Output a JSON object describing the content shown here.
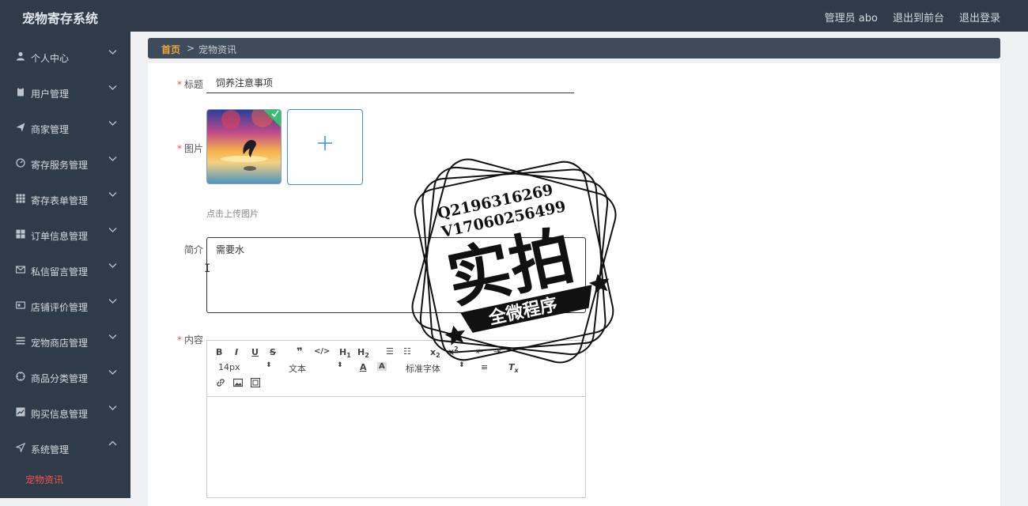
{
  "app": {
    "title": "宠物寄存系统"
  },
  "top_links": {
    "admin": "管理员 abo",
    "front": "退出到前台",
    "logout": "退出登录"
  },
  "sidebar": {
    "items": [
      {
        "label": "个人中心",
        "icon": "user-icon"
      },
      {
        "label": "用户管理",
        "icon": "clipboard-icon"
      },
      {
        "label": "商家管理",
        "icon": "paper-plane-icon"
      },
      {
        "label": "寄存服务管理",
        "icon": "dashboard-icon"
      },
      {
        "label": "寄存表单管理",
        "icon": "grid-icon"
      },
      {
        "label": "订单信息管理",
        "icon": "apps-icon"
      },
      {
        "label": "私信留言管理",
        "icon": "mail-icon"
      },
      {
        "label": "店铺评价管理",
        "icon": "card-icon"
      },
      {
        "label": "宠物商店管理",
        "icon": "list-icon"
      },
      {
        "label": "商品分类管理",
        "icon": "compass-icon"
      },
      {
        "label": "购买信息管理",
        "icon": "chart-icon"
      },
      {
        "label": "系统管理",
        "icon": "send-icon"
      }
    ],
    "sub_item": "宠物资讯"
  },
  "breadcrumb": {
    "home": "首页",
    "separator": ">",
    "current": "宠物资讯"
  },
  "form": {
    "title_label": "标题",
    "title_value": "饲养注意事项",
    "image_label": "图片",
    "upload_hint": "点击上传图片",
    "intro_label": "简介",
    "intro_value": "需要水",
    "content_label": "内容",
    "toolbar": {
      "font_size": "14px",
      "text_style": "文本",
      "font_family": "标准字体"
    }
  },
  "watermark": {
    "line1": "Q2196316269",
    "line2": "V17060256499",
    "big": "实拍",
    "banner": "全微程序"
  },
  "colors": {
    "sidebar_bg": "#2f3b48",
    "accent_red": "#f0554a",
    "home_orange": "#f0a53b",
    "upload_blue": "#3d8ee6"
  }
}
